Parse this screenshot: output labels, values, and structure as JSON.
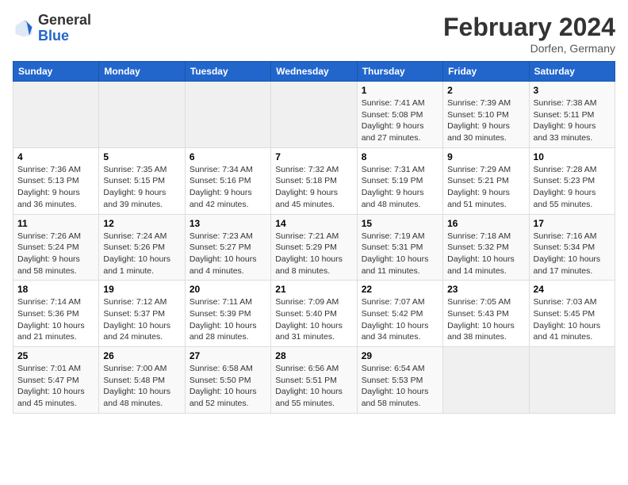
{
  "header": {
    "logo_general": "General",
    "logo_blue": "Blue",
    "month_title": "February 2024",
    "location": "Dorfen, Germany"
  },
  "weekdays": [
    "Sunday",
    "Monday",
    "Tuesday",
    "Wednesday",
    "Thursday",
    "Friday",
    "Saturday"
  ],
  "weeks": [
    [
      {
        "day": "",
        "info": ""
      },
      {
        "day": "",
        "info": ""
      },
      {
        "day": "",
        "info": ""
      },
      {
        "day": "",
        "info": ""
      },
      {
        "day": "1",
        "info": "Sunrise: 7:41 AM\nSunset: 5:08 PM\nDaylight: 9 hours\nand 27 minutes."
      },
      {
        "day": "2",
        "info": "Sunrise: 7:39 AM\nSunset: 5:10 PM\nDaylight: 9 hours\nand 30 minutes."
      },
      {
        "day": "3",
        "info": "Sunrise: 7:38 AM\nSunset: 5:11 PM\nDaylight: 9 hours\nand 33 minutes."
      }
    ],
    [
      {
        "day": "4",
        "info": "Sunrise: 7:36 AM\nSunset: 5:13 PM\nDaylight: 9 hours\nand 36 minutes."
      },
      {
        "day": "5",
        "info": "Sunrise: 7:35 AM\nSunset: 5:15 PM\nDaylight: 9 hours\nand 39 minutes."
      },
      {
        "day": "6",
        "info": "Sunrise: 7:34 AM\nSunset: 5:16 PM\nDaylight: 9 hours\nand 42 minutes."
      },
      {
        "day": "7",
        "info": "Sunrise: 7:32 AM\nSunset: 5:18 PM\nDaylight: 9 hours\nand 45 minutes."
      },
      {
        "day": "8",
        "info": "Sunrise: 7:31 AM\nSunset: 5:19 PM\nDaylight: 9 hours\nand 48 minutes."
      },
      {
        "day": "9",
        "info": "Sunrise: 7:29 AM\nSunset: 5:21 PM\nDaylight: 9 hours\nand 51 minutes."
      },
      {
        "day": "10",
        "info": "Sunrise: 7:28 AM\nSunset: 5:23 PM\nDaylight: 9 hours\nand 55 minutes."
      }
    ],
    [
      {
        "day": "11",
        "info": "Sunrise: 7:26 AM\nSunset: 5:24 PM\nDaylight: 9 hours\nand 58 minutes."
      },
      {
        "day": "12",
        "info": "Sunrise: 7:24 AM\nSunset: 5:26 PM\nDaylight: 10 hours\nand 1 minute."
      },
      {
        "day": "13",
        "info": "Sunrise: 7:23 AM\nSunset: 5:27 PM\nDaylight: 10 hours\nand 4 minutes."
      },
      {
        "day": "14",
        "info": "Sunrise: 7:21 AM\nSunset: 5:29 PM\nDaylight: 10 hours\nand 8 minutes."
      },
      {
        "day": "15",
        "info": "Sunrise: 7:19 AM\nSunset: 5:31 PM\nDaylight: 10 hours\nand 11 minutes."
      },
      {
        "day": "16",
        "info": "Sunrise: 7:18 AM\nSunset: 5:32 PM\nDaylight: 10 hours\nand 14 minutes."
      },
      {
        "day": "17",
        "info": "Sunrise: 7:16 AM\nSunset: 5:34 PM\nDaylight: 10 hours\nand 17 minutes."
      }
    ],
    [
      {
        "day": "18",
        "info": "Sunrise: 7:14 AM\nSunset: 5:36 PM\nDaylight: 10 hours\nand 21 minutes."
      },
      {
        "day": "19",
        "info": "Sunrise: 7:12 AM\nSunset: 5:37 PM\nDaylight: 10 hours\nand 24 minutes."
      },
      {
        "day": "20",
        "info": "Sunrise: 7:11 AM\nSunset: 5:39 PM\nDaylight: 10 hours\nand 28 minutes."
      },
      {
        "day": "21",
        "info": "Sunrise: 7:09 AM\nSunset: 5:40 PM\nDaylight: 10 hours\nand 31 minutes."
      },
      {
        "day": "22",
        "info": "Sunrise: 7:07 AM\nSunset: 5:42 PM\nDaylight: 10 hours\nand 34 minutes."
      },
      {
        "day": "23",
        "info": "Sunrise: 7:05 AM\nSunset: 5:43 PM\nDaylight: 10 hours\nand 38 minutes."
      },
      {
        "day": "24",
        "info": "Sunrise: 7:03 AM\nSunset: 5:45 PM\nDaylight: 10 hours\nand 41 minutes."
      }
    ],
    [
      {
        "day": "25",
        "info": "Sunrise: 7:01 AM\nSunset: 5:47 PM\nDaylight: 10 hours\nand 45 minutes."
      },
      {
        "day": "26",
        "info": "Sunrise: 7:00 AM\nSunset: 5:48 PM\nDaylight: 10 hours\nand 48 minutes."
      },
      {
        "day": "27",
        "info": "Sunrise: 6:58 AM\nSunset: 5:50 PM\nDaylight: 10 hours\nand 52 minutes."
      },
      {
        "day": "28",
        "info": "Sunrise: 6:56 AM\nSunset: 5:51 PM\nDaylight: 10 hours\nand 55 minutes."
      },
      {
        "day": "29",
        "info": "Sunrise: 6:54 AM\nSunset: 5:53 PM\nDaylight: 10 hours\nand 58 minutes."
      },
      {
        "day": "",
        "info": ""
      },
      {
        "day": "",
        "info": ""
      }
    ]
  ]
}
